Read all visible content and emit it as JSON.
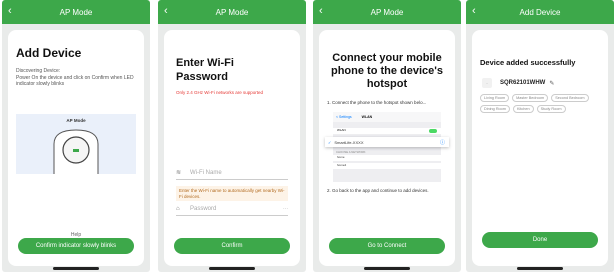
{
  "screens": [
    {
      "header": {
        "back_icon": "chevron-left-icon",
        "title": "AP Mode"
      },
      "title": "Add Device",
      "description": "Discovering Device:\nPower On the device and click on Confirm when LED indicator slowly blinks",
      "illustration_label": "AP Mode",
      "help": "Help",
      "button": "Confirm indicator slowly blinks"
    },
    {
      "header": {
        "back_icon": "chevron-left-icon",
        "title": "AP Mode"
      },
      "title": "Enter Wi-Fi Password",
      "warning": "Only 2.4 GHz Wi-Fi networks are supported",
      "wifi_placeholder": "Wi-Fi Name",
      "hint": "Enter the Wi-Fi name to automatically get nearby Wi-Fi devices.",
      "password_placeholder": "Password",
      "button": "Confirm"
    },
    {
      "header": {
        "back_icon": "chevron-left-icon",
        "title": "AP Mode"
      },
      "title": "Connect your mobile phone to the device's hotspot",
      "step1": "1. Connect the phone to the hotspot shown belo...",
      "shot": {
        "back": "< Settings",
        "title": "WLAN",
        "wlan": "WLAN",
        "network": "SmartLife-XXXX",
        "section": "CHOOSE A NETWORK",
        "other1": "home",
        "other2": "home4"
      },
      "step2": "2. Go back to the app and continue to add devices.",
      "button": "Go to Connect"
    },
    {
      "header": {
        "back_icon": "chevron-left-icon",
        "title": "Add Device"
      },
      "title": "Device added successfully",
      "device_name": "SQR62101WHW",
      "edit_icon": "pencil-icon",
      "rooms": [
        "Living Room",
        "Master Bedroom",
        "Second Bedroom",
        "Dining Room",
        "Kitchen",
        "Study Room"
      ],
      "button": "Done"
    }
  ],
  "colors": {
    "accent": "#3da84a",
    "warning": "#e53935",
    "background": "#e9ebea"
  }
}
